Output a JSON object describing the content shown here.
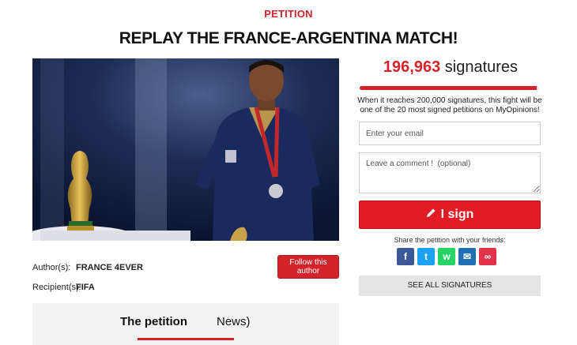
{
  "header": {
    "kicker": "PETITION",
    "title": "REPLAY THE FRANCE-ARGENTINA MATCH!"
  },
  "petition": {
    "author_label": "Author(s):",
    "author_value": "FRANCE 4EVER",
    "recipient_label": "Recipient(s):",
    "recipient_value": "FIFA",
    "follow_button": "Follow this author"
  },
  "tabs": [
    {
      "label": "The petition",
      "active": true
    },
    {
      "label": "News)",
      "active": false
    }
  ],
  "sidebar": {
    "signature_count": "196,963",
    "signature_word": "signatures",
    "progress_fraction": 0.985,
    "info_text": "When it reaches 200,000 signatures, this fight will be one of the 20 most signed petitions on MyOpinions!",
    "email_placeholder": "Enter your email",
    "comment_placeholder": "Leave a comment !  (optional)",
    "sign_label": "I sign",
    "share_text": "Share the petition with your friends:",
    "share_buttons": [
      {
        "name": "facebook-icon",
        "glyph": "f",
        "color": "#3b5998"
      },
      {
        "name": "twitter-icon",
        "glyph": "t",
        "color": "#1da1f2"
      },
      {
        "name": "whatsapp-icon",
        "glyph": "w",
        "color": "#25d366"
      },
      {
        "name": "email-icon",
        "glyph": "✉",
        "color": "#1f6fb5"
      },
      {
        "name": "link-icon",
        "glyph": "∞",
        "color": "#e0334a"
      }
    ],
    "see_all_label": "SEE ALL SIGNATURES"
  },
  "colors": {
    "brand_red": "#d2232a",
    "photo_background": "#0d1b3c"
  }
}
